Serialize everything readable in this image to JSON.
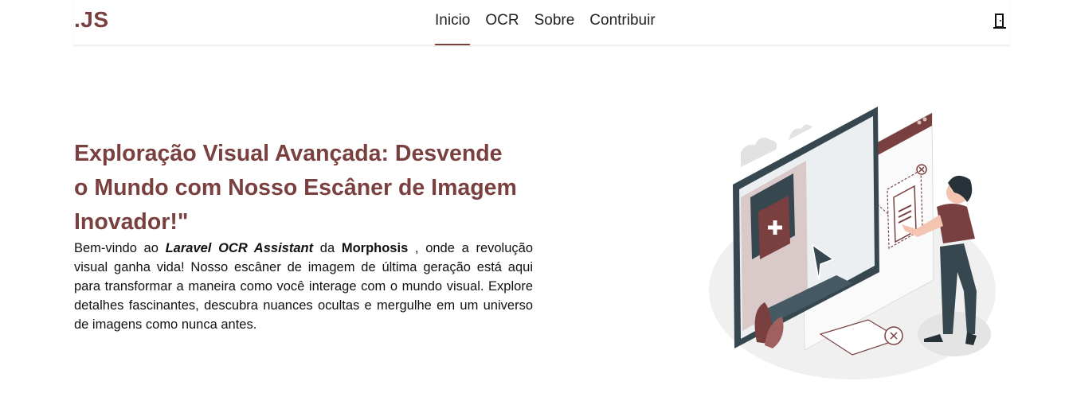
{
  "navbar": {
    "brand": ".JS",
    "links": [
      {
        "label": "Inicio",
        "active": true
      },
      {
        "label": "OCR",
        "active": false
      },
      {
        "label": "Sobre",
        "active": false
      },
      {
        "label": "Contribuir",
        "active": false
      }
    ],
    "exit_icon": "door-exit-icon"
  },
  "hero": {
    "title": "Exploração Visual Avançada: Desvende o Mundo com Nosso Escâner de Imagem Inovador!\"",
    "text_prefix": "Bem-vindo ao ",
    "product_name": "Laravel OCR Assistant",
    "text_mid": " da ",
    "company_name": "Morphosis",
    "text_suffix": " , onde a revolução visual ganha vida! Nosso escâner de imagem de última geração está aqui para transformar a maneira como você interage com o mundo visual. Explore detalhes fascinantes, descubra nuances ocultas e mergulhe em um universo de imagens como nunca antes."
  },
  "colors": {
    "accent": "#7a4040",
    "text": "#111111",
    "illustration_gray": "#eeeeee",
    "monitor_dark": "#37474f"
  }
}
